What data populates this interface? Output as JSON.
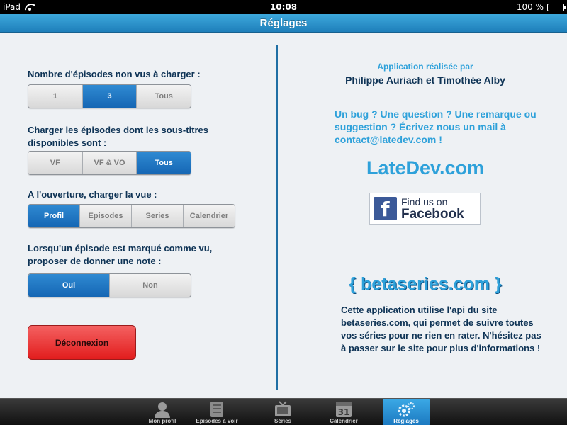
{
  "status_bar": {
    "device": "iPad",
    "time": "10:08",
    "battery": "100 %",
    "battery_level": 1.0
  },
  "navbar": {
    "title": "Réglages"
  },
  "settings": {
    "q1": {
      "label": "Nombre d'épisodes non vus à charger :",
      "options": [
        "1",
        "3",
        "Tous"
      ],
      "selected": "3"
    },
    "q2": {
      "label": "Charger les épisodes dont les sous-titres disponibles sont :",
      "options": [
        "VF",
        "VF & VO",
        "Tous"
      ],
      "selected": "Tous"
    },
    "q3": {
      "label": "A l'ouverture, charger la vue :",
      "options": [
        "Profil",
        "Episodes",
        "Series",
        "Calendrier"
      ],
      "selected": "Profil"
    },
    "q4": {
      "label": "Lorsqu'un épisode est marqué comme vu, proposer de donner une note :",
      "options": [
        "Oui",
        "Non"
      ],
      "selected": "Oui"
    },
    "logout_label": "Déconnexion"
  },
  "about": {
    "made_by": "Application réalisée par",
    "authors": "Philippe Auriach et Timothée Alby",
    "bug_text": "Un bug ? Une question ? Une remarque ou suggestion ? Écrivez nous un mail à contact@latedev.com !",
    "site": "LateDev.com",
    "facebook_line1": "Find us on",
    "facebook_line2": "Facebook",
    "facebook_icon_letter": "f",
    "betaseries_logo": "{ betaseries.com }",
    "api_text": "Cette application utilise l'api du site betaseries.com, qui permet de suivre toutes vos séries pour ne rien en rater. N'hésitez pas à passer sur le site pour plus d'informations !"
  },
  "tabbar": {
    "tabs": [
      {
        "label": "Mon profil",
        "icon": "person-icon"
      },
      {
        "label": "Episodes à voir",
        "icon": "list-icon"
      },
      {
        "label": "Séries",
        "icon": "tv-icon"
      },
      {
        "label": "Calendrier",
        "icon": "calendar-icon",
        "icon_text": "31"
      },
      {
        "label": "Réglages",
        "icon": "gears-icon"
      }
    ],
    "active": "Réglages"
  },
  "colors": {
    "accent": "#1f6fa4",
    "light_blue_text": "#2ea1da",
    "dark_text": "#0e3355",
    "logout_red": "#e21d1d"
  }
}
